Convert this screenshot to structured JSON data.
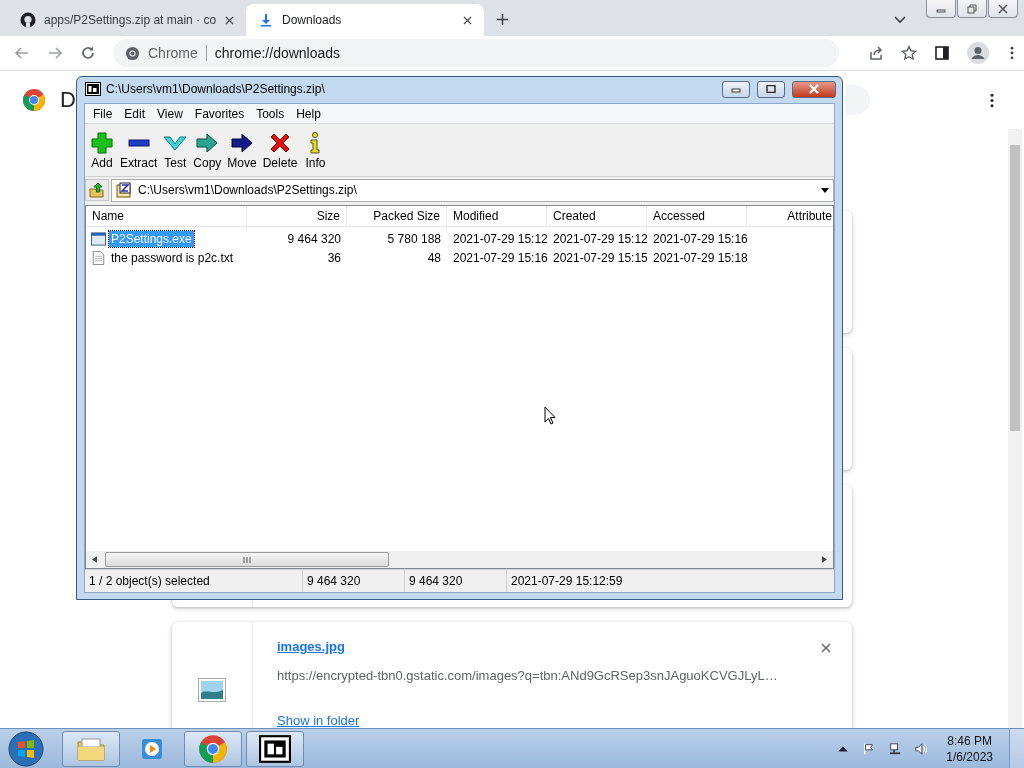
{
  "browser": {
    "tabs": [
      {
        "title": "apps/P2Settings.zip at main · co",
        "kind": "github",
        "selected": false
      },
      {
        "title": "Downloads",
        "kind": "download",
        "selected": true
      }
    ],
    "address": {
      "site_label": "Chrome",
      "url": "chrome://downloads"
    }
  },
  "page": {
    "title": "D",
    "downloads": [
      {
        "kind": "hidden"
      },
      {
        "kind": "hidden"
      },
      {
        "kind": "hidden"
      },
      {
        "kind": "visible",
        "file": "images.jpg",
        "url": "https://encrypted-tbn0.gstatic.com/images?q=tbn:ANd9GcRSep3snJAguoKCVGJLyL…",
        "action": "Show in folder"
      }
    ]
  },
  "archive_window": {
    "title": "C:\\Users\\vm1\\Downloads\\P2Settings.zip\\",
    "menu": [
      "File",
      "Edit",
      "View",
      "Favorites",
      "Tools",
      "Help"
    ],
    "toolbar": [
      {
        "label": "Add",
        "kind": "add"
      },
      {
        "label": "Extract",
        "kind": "extract"
      },
      {
        "label": "Test",
        "kind": "test"
      },
      {
        "label": "Copy",
        "kind": "copy"
      },
      {
        "label": "Move",
        "kind": "move"
      },
      {
        "label": "Delete",
        "kind": "delete"
      },
      {
        "label": "Info",
        "kind": "info"
      }
    ],
    "path": "C:\\Users\\vm1\\Downloads\\P2Settings.zip\\",
    "columns": [
      "Name",
      "Size",
      "Packed Size",
      "Modified",
      "Created",
      "Accessed",
      "Attribute"
    ],
    "rows": [
      {
        "name": "P2Settings.exe",
        "kind": "exe",
        "size": "9 464 320",
        "packed_size": "5 780 188",
        "modified": "2021-07-29 15:12",
        "created": "2021-07-29 15:12",
        "accessed": "2021-07-29 15:16",
        "selected": true
      },
      {
        "name": "the password is p2c.txt",
        "kind": "txt",
        "size": "36",
        "packed_size": "48",
        "modified": "2021-07-29 15:16",
        "created": "2021-07-29 15:15",
        "accessed": "2021-07-29 15:18",
        "selected": false
      }
    ],
    "status": [
      "1 / 2 object(s) selected",
      "9 464 320",
      "9 464 320",
      "2021-07-29 15:12:59"
    ]
  },
  "taskbar": {
    "apps": [
      {
        "kind": "explorer"
      },
      {
        "kind": "media"
      },
      {
        "kind": "chrome"
      },
      {
        "kind": "archiver"
      }
    ],
    "time": "8:46 PM",
    "date": "1/6/2023"
  }
}
